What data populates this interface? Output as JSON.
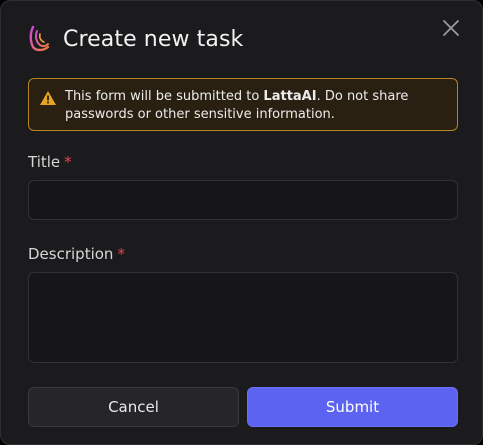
{
  "dialog": {
    "title": "Create new task",
    "close_icon": "close-icon",
    "logo_icon": "latta-logo-icon"
  },
  "warning": {
    "icon": "warning-triangle-icon",
    "text_before": "This form will be submitted to ",
    "brand": "LattaAI",
    "text_after": ". Do not share passwords or other sensitive information."
  },
  "form": {
    "title_label": "Title",
    "title_required": "*",
    "title_value": "",
    "description_label": "Description",
    "description_required": "*",
    "description_value": ""
  },
  "buttons": {
    "cancel_label": "Cancel",
    "submit_label": "Submit"
  },
  "colors": {
    "accent": "#5b63f0",
    "warning_border": "#b98322",
    "required": "#e5484d"
  }
}
